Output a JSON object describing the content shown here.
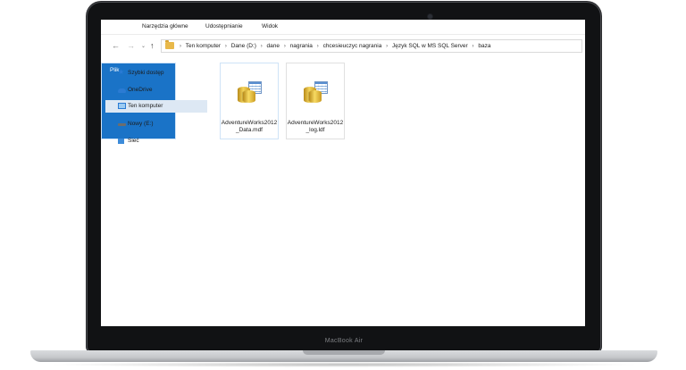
{
  "device": {
    "model_label": "MacBook Air"
  },
  "ribbon": {
    "tabs": [
      "Plik",
      "Narzędzia główne",
      "Udostępnianie",
      "Widok"
    ]
  },
  "address_bar": {
    "breadcrumbs": [
      "Ten komputer",
      "Dane (D:)",
      "dane",
      "nagrania",
      "chcesieuczyc nagrania",
      "Język SQL w MS SQL Server",
      "baza"
    ]
  },
  "sidebar": {
    "items": [
      {
        "label": "Szybki dostęp",
        "icon": "star-icon"
      },
      {
        "label": "OneDrive",
        "icon": "cloud-icon"
      },
      {
        "label": "Ten komputer",
        "icon": "computer-icon",
        "selected": true
      },
      {
        "label": "Nowy (E:)",
        "icon": "drive-icon"
      },
      {
        "label": "Sieć",
        "icon": "network-icon"
      }
    ]
  },
  "files": [
    {
      "name": "AdventureWorks2012_Data.mdf",
      "icon": "database-file-icon"
    },
    {
      "name": "AdventureWorks2012_log.ldf",
      "icon": "database-file-icon"
    }
  ],
  "colors": {
    "accent": "#1a73c7",
    "selection": "#dde8f4",
    "folder": "#e8b84a"
  }
}
